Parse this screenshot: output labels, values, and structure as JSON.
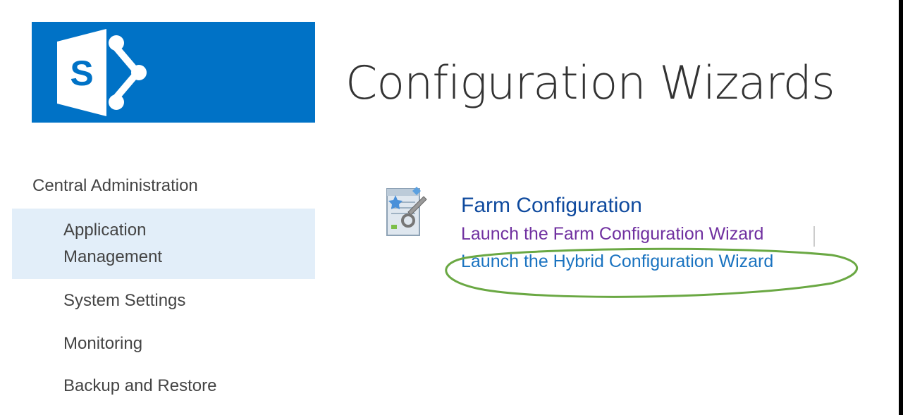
{
  "brand": {
    "color": "#0072c6",
    "icon": "sharepoint-logo",
    "letter": "S"
  },
  "page": {
    "title": "Configuration Wizards"
  },
  "quicklaunch": {
    "header": "Central Administration",
    "items": [
      {
        "label": "Application Management",
        "selected": true
      },
      {
        "label": "System Settings"
      },
      {
        "label": "Monitoring"
      },
      {
        "label": "Backup and Restore"
      }
    ]
  },
  "section": {
    "icon": "farm-configuration-icon",
    "title": "Farm Configuration",
    "links": [
      {
        "label": "Launch the Farm Configuration Wizard",
        "color": "#7030a0"
      },
      {
        "label": "Launch the Hybrid Configuration Wizard",
        "color": "#1a73c0",
        "highlighted": true
      }
    ]
  },
  "annotation": {
    "shape": "ellipse",
    "color": "#6aa843"
  }
}
